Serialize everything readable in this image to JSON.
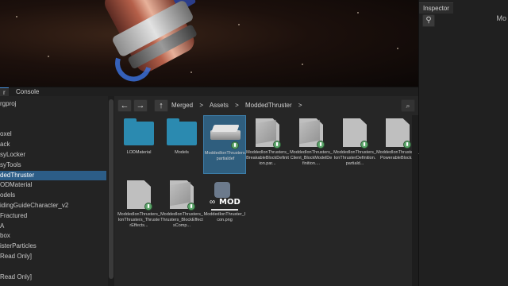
{
  "inspector": {
    "tab_label": "Inspector",
    "title_fragment": "Mo",
    "pin_icon": "pin-icon"
  },
  "panel_tabs": {
    "left_tab_fragment": "r",
    "console_label": "Console"
  },
  "tree": {
    "items": [
      {
        "label": "rgproj",
        "selected": false
      },
      {
        "label": "",
        "selected": false
      },
      {
        "label": "",
        "selected": false
      },
      {
        "label": "oxel",
        "selected": false
      },
      {
        "label": "ack",
        "selected": false
      },
      {
        "label": "syLocker",
        "selected": false
      },
      {
        "label": "syTools",
        "selected": false
      },
      {
        "label": "dedThruster",
        "selected": true
      },
      {
        "label": "ODMaterial",
        "selected": false
      },
      {
        "label": "odels",
        "selected": false
      },
      {
        "label": "idingGuideCharacter_v2",
        "selected": false
      },
      {
        "label": "Fractured",
        "selected": false
      },
      {
        "label": "A",
        "selected": false
      },
      {
        "label": "box",
        "selected": false
      },
      {
        "label": "isterParticles",
        "selected": false
      },
      {
        "label": "Read Only]",
        "selected": false
      },
      {
        "label": "",
        "selected": false
      },
      {
        "label": "Read Only]",
        "selected": false
      }
    ]
  },
  "toolbar": {
    "back_icon": "arrow-left-icon",
    "forward_icon": "arrow-right-icon",
    "up_icon": "arrow-up-icon",
    "breadcrumbs": [
      "Merged",
      ">",
      "Assets",
      ">",
      "ModdedThruster",
      ">"
    ],
    "search_icon": "search-icon"
  },
  "assets": [
    {
      "label": "LODMaterial",
      "kind": "folder",
      "selected": false
    },
    {
      "label": "Models",
      "kind": "folder",
      "selected": false
    },
    {
      "label": "ModdedIonThrusters.partialdef",
      "kind": "platform",
      "selected": true
    },
    {
      "label": "ModdedIonThrusters_BreakableBlockDefinition.par...",
      "kind": "doc-special",
      "selected": false
    },
    {
      "label": "ModdedIonThrusters_Client_BlockModelDefinition....",
      "kind": "doc-cube",
      "selected": false
    },
    {
      "label": "ModdedIonThrusters_IonThrusterDefinition.partiald...",
      "kind": "doc",
      "selected": false
    },
    {
      "label": "ModdedIonThrusters_PowerableBlock...",
      "kind": "doc",
      "selected": false
    },
    {
      "label": "ModdedIonThrusters_IonThrusters_ThrusterEffects...",
      "kind": "doc",
      "selected": false
    },
    {
      "label": "ModdedIonThrusters_Thrusters_BlockEffectsComp...",
      "kind": "doc-grid",
      "selected": false
    },
    {
      "label": "ModdedIonThruster_Icon.png",
      "kind": "mod-image",
      "selected": false
    }
  ],
  "mod_icon_text": "MOD"
}
